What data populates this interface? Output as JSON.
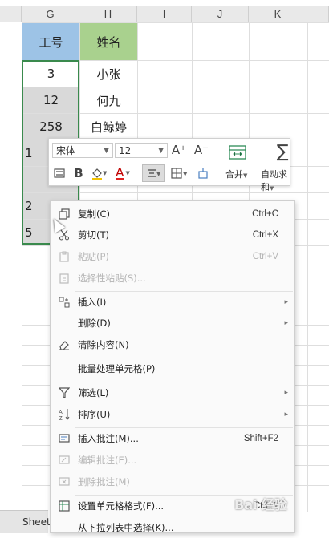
{
  "columns": [
    "G",
    "H",
    "I",
    "J",
    "K"
  ],
  "cells": {
    "header_g": "工号",
    "header_h": "姓名",
    "rows": [
      {
        "g": "3",
        "h": "小张"
      },
      {
        "g": "12",
        "h": "何九"
      },
      {
        "g": "258",
        "h": "白鲸婷"
      },
      {
        "g": "1",
        "h": ""
      },
      {
        "g": "",
        "h": ""
      },
      {
        "g": "2",
        "h": ""
      },
      {
        "g": "5",
        "h": ""
      }
    ]
  },
  "mini_toolbar": {
    "font_name": "宋体",
    "font_size": "12",
    "grow_label": "A⁺",
    "shrink_label": "A⁻",
    "merge_label": "合并",
    "autosum_label": "自动求和",
    "bold_label": "B",
    "font_color_label": "A"
  },
  "context_menu": {
    "items": [
      {
        "label": "复制(C)",
        "shortcut": "Ctrl+C",
        "icon": "copy-icon"
      },
      {
        "label": "剪切(T)",
        "shortcut": "Ctrl+X",
        "icon": "cut-icon"
      },
      {
        "label": "粘贴(P)",
        "shortcut": "Ctrl+V",
        "icon": "paste-icon"
      },
      {
        "label": "选择性粘贴(S)...",
        "shortcut": "",
        "icon": "paste-special-icon"
      },
      {
        "label": "插入(I)",
        "shortcut": "",
        "icon": "insert-icon"
      },
      {
        "label": "删除(D)",
        "shortcut": "",
        "icon": ""
      },
      {
        "label": "清除内容(N)",
        "shortcut": "",
        "icon": "eraser-icon"
      },
      {
        "label": "批量处理单元格(P)",
        "shortcut": "",
        "icon": ""
      },
      {
        "label": "筛选(L)",
        "shortcut": "",
        "icon": "filter-icon"
      },
      {
        "label": "排序(U)",
        "shortcut": "",
        "icon": "sort-icon"
      },
      {
        "label": "插入批注(M)...",
        "shortcut": "Shift+F2",
        "icon": "insert-comment-icon"
      },
      {
        "label": "编辑批注(E)...",
        "shortcut": "",
        "icon": "edit-comment-icon"
      },
      {
        "label": "删除批注(M)",
        "shortcut": "",
        "icon": "delete-comment-icon"
      },
      {
        "label": "设置单元格格式(F)...",
        "shortcut": "Ctrl+1",
        "icon": "format-cells-icon"
      },
      {
        "label": "从下拉列表中选择(K)...",
        "shortcut": "",
        "icon": ""
      }
    ]
  },
  "sheet_tab": "Sheet",
  "watermark": "Bai 经验"
}
